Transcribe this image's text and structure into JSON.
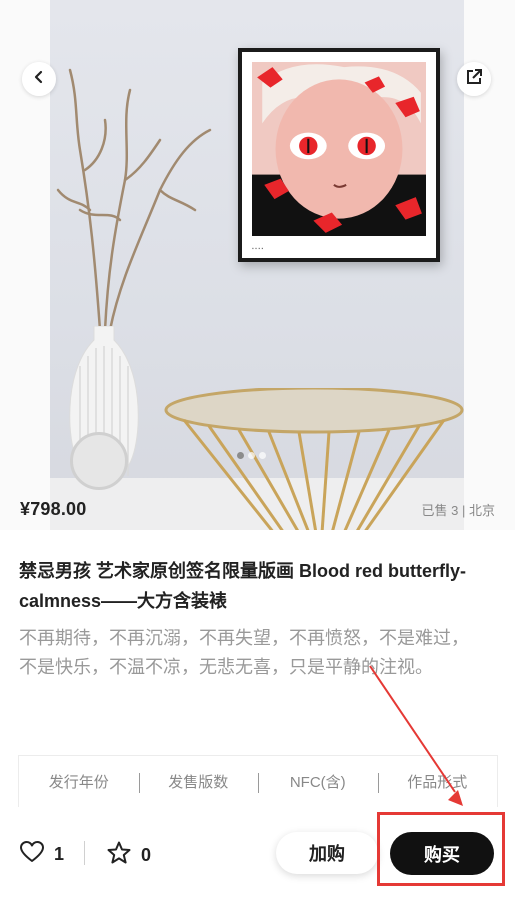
{
  "product": {
    "price": "¥798.00",
    "sales_info": "已售 3 | 北京",
    "title": "禁忌男孩 艺术家原创签名限量版画 Blood red butterfly-calmness——大方含装裱",
    "description": "不再期待，不再沉溺，不再失望，不再愤怒，不是难过，不是快乐，不温不凉，无悲无喜，只是平静的注视。"
  },
  "gallery": {
    "dot_count": 3,
    "active_index": 0
  },
  "attributes": [
    "发行年份",
    "发售版数",
    "NFC(含)",
    "作品形式"
  ],
  "bottom_bar": {
    "like_count": "1",
    "star_count": "0",
    "add_to_cart": "加购",
    "buy": "购买"
  },
  "colors": {
    "accent_red": "#e53935",
    "buy_button": "#111111",
    "art_red": "#e8262b"
  },
  "icons": [
    "back-arrow-icon",
    "share-icon",
    "heart-icon",
    "star-icon"
  ]
}
